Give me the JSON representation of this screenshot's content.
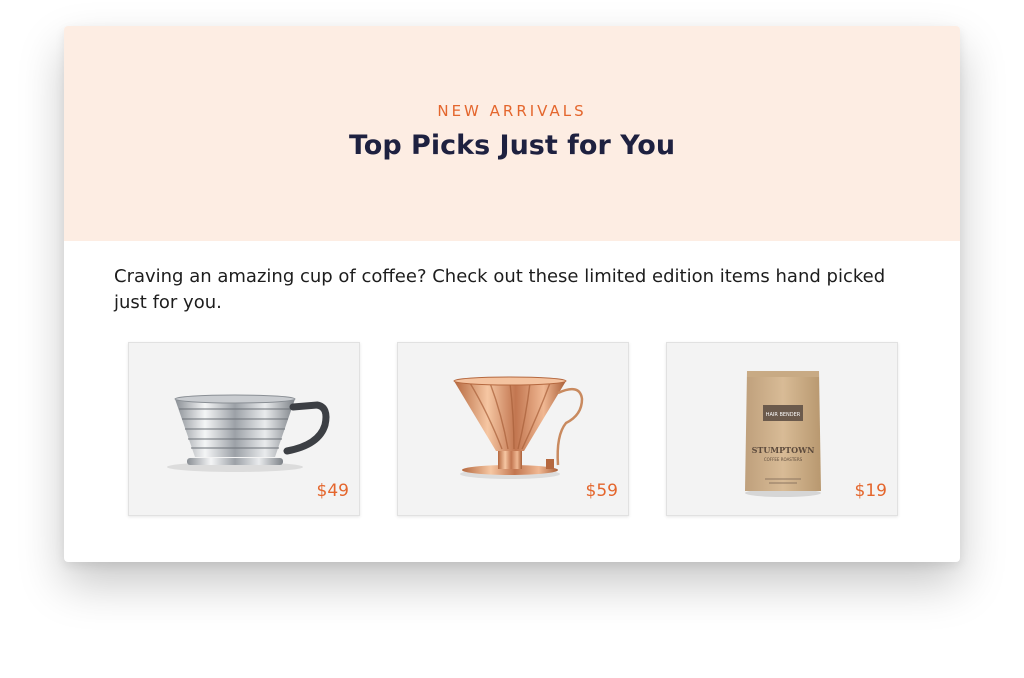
{
  "hero": {
    "eyebrow": "NEW ARRIVALS",
    "title": "Top Picks Just for You"
  },
  "intro": "Craving an amazing cup of coffee? Check out these limited edition items hand picked just for you.",
  "products": [
    {
      "icon": "steel-pour-over-dripper-icon",
      "price": "$49"
    },
    {
      "icon": "copper-pour-over-dripper-icon",
      "price": "$59"
    },
    {
      "icon": "coffee-bag-icon",
      "price": "$19",
      "bag_label": "HAIR BENDER",
      "bag_brand": "STUMPTOWN",
      "bag_subbrand": "COFFEE ROASTERS"
    }
  ],
  "colors": {
    "accent": "#e4662d",
    "hero_bg": "#fdede3",
    "title": "#1e2140"
  }
}
